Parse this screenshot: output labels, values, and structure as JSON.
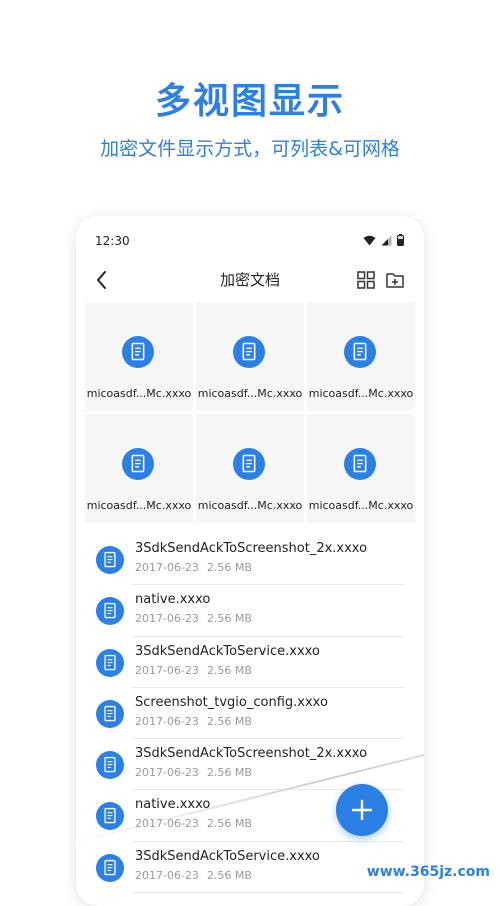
{
  "headline": "多视图显示",
  "subtitle": "加密文件显示方式，可列表&可网格",
  "status_bar": {
    "time": "12:30"
  },
  "app_bar": {
    "title": "加密文档"
  },
  "grid": {
    "items": [
      {
        "name": "micoasdf...Mc.xxxo"
      },
      {
        "name": "micoasdf...Mc.xxxo"
      },
      {
        "name": "micoasdf...Mc.xxxo"
      },
      {
        "name": "micoasdf...Mc.xxxo"
      },
      {
        "name": "micoasdf...Mc.xxxo"
      },
      {
        "name": "micoasdf...Mc.xxxo"
      }
    ]
  },
  "list": {
    "items": [
      {
        "name": "3SdkSendAckToScreenshot_2x.xxxo",
        "date": "2017-06-23",
        "size": "2.56 MB"
      },
      {
        "name": "native.xxxo",
        "date": "2017-06-23",
        "size": "2.56 MB"
      },
      {
        "name": "3SdkSendAckToService.xxxo",
        "date": "2017-06-23",
        "size": "2.56 MB"
      },
      {
        "name": "Screenshot_tvgio_config.xxxo",
        "date": "2017-06-23",
        "size": "2.56 MB"
      },
      {
        "name": "3SdkSendAckToScreenshot_2x.xxxo",
        "date": "2017-06-23",
        "size": "2.56 MB"
      },
      {
        "name": "native.xxxo",
        "date": "2017-06-23",
        "size": "2.56 MB"
      },
      {
        "name": "3SdkSendAckToService.xxxo",
        "date": "2017-06-23",
        "size": "2.56 MB"
      }
    ]
  },
  "watermark": "www.365jz.com",
  "colors": {
    "accent": "#2b80e6",
    "muted_text": "#9a9a9a",
    "cell_bg": "#f6f6f6"
  },
  "icons": [
    "wifi-icon",
    "signal-icon",
    "battery-icon",
    "back-arrow-icon",
    "grid-view-icon",
    "add-folder-icon",
    "document-icon",
    "plus-icon"
  ]
}
